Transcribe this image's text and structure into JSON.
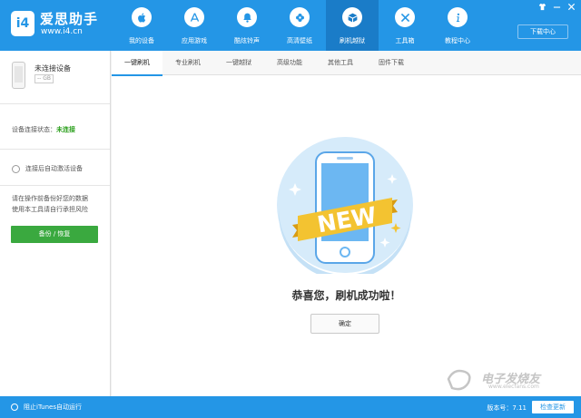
{
  "app": {
    "logo_badge": "i4",
    "logo_title": "爱思助手",
    "logo_url": "www.i4.cn"
  },
  "nav": [
    {
      "label": "我的设备",
      "icon": "apple-icon"
    },
    {
      "label": "应用游戏",
      "icon": "appstore-icon"
    },
    {
      "label": "酷炫铃声",
      "icon": "bell-icon"
    },
    {
      "label": "高清壁纸",
      "icon": "flower-icon"
    },
    {
      "label": "刷机越狱",
      "icon": "box-icon",
      "active": true
    },
    {
      "label": "工具箱",
      "icon": "tools-icon"
    },
    {
      "label": "教程中心",
      "icon": "info-icon"
    }
  ],
  "window": {
    "download_label": "下载中心"
  },
  "sidebar": {
    "device_name": "未连接设备",
    "device_gb": "-- GB",
    "status_label": "设备连接状态：",
    "status_value": "未连接",
    "auto_activate": "连接后自动激活设备",
    "tip_line1": "请在操作前备份好您的数据",
    "tip_line2": "使用本工具请自行承担风险",
    "backup_button": "备份 / 恢复"
  },
  "tabs": [
    {
      "label": "一键刷机",
      "active": true
    },
    {
      "label": "专业刷机"
    },
    {
      "label": "一键越狱"
    },
    {
      "label": "高级功能"
    },
    {
      "label": "其他工具"
    },
    {
      "label": "固件下载"
    }
  ],
  "main": {
    "banner_text": "NEW",
    "success_message": "恭喜您，刷机成功啦！",
    "ok_button": "确定"
  },
  "bottom": {
    "itunes_label": "阻止iTunes自动运行",
    "version": "版本号：7.11",
    "update_button": "检查更新"
  },
  "watermark": {
    "text": "电子发烧友",
    "url": "www.elecfans.com"
  },
  "colors": {
    "primary": "#2496e6",
    "nav_active": "#1a7cc8",
    "green": "#3aa93f",
    "status_green": "#2da01e",
    "banner": "#f3c331"
  }
}
